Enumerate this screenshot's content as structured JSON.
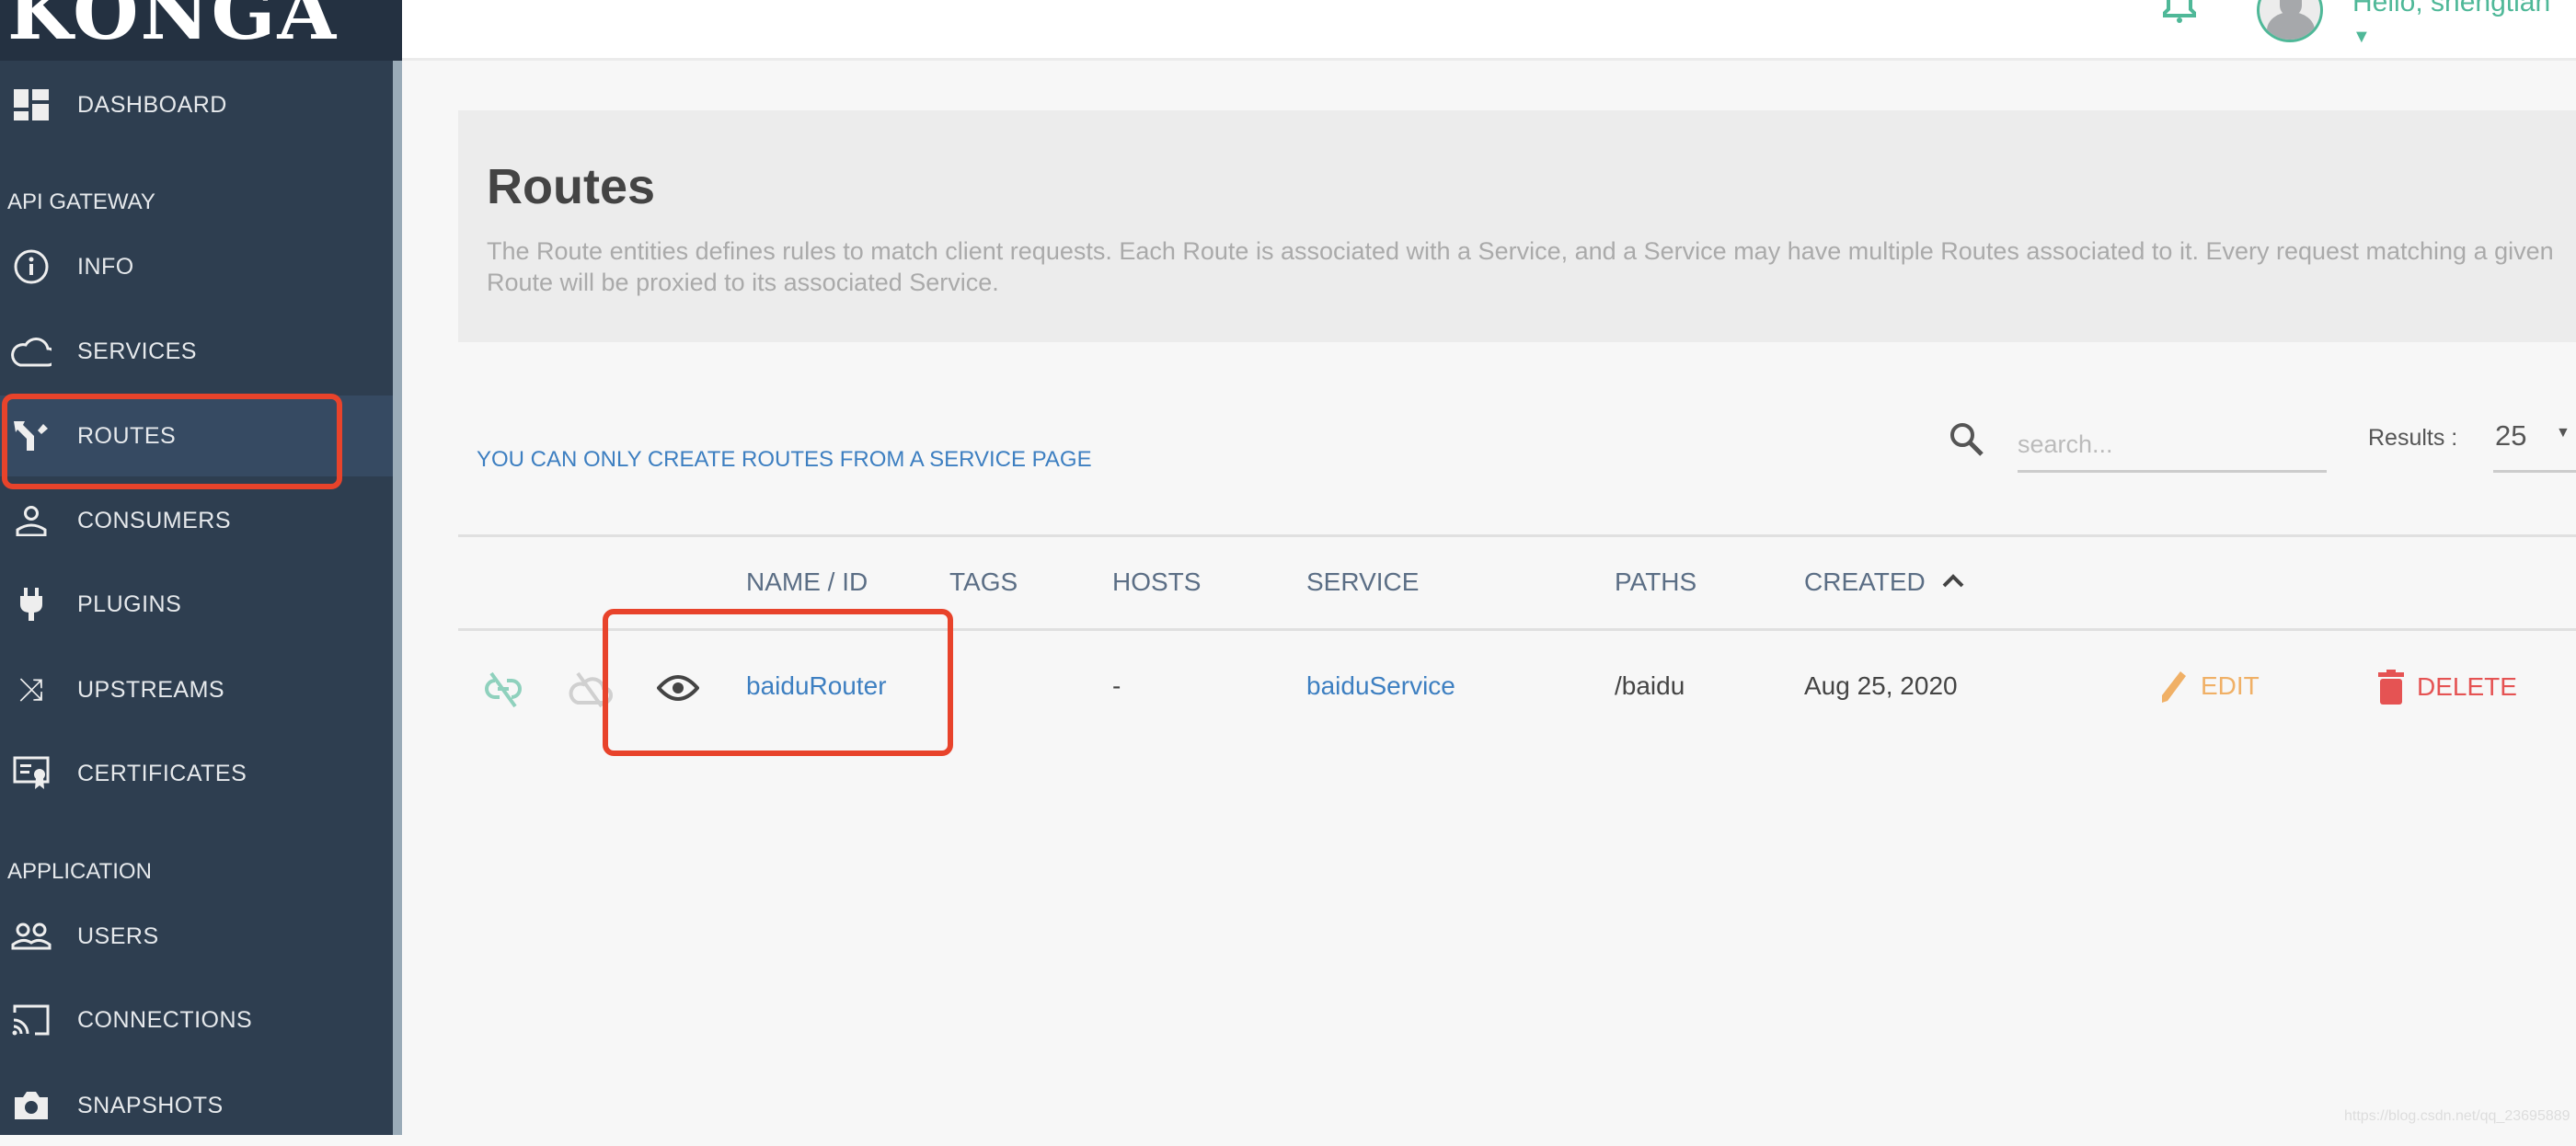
{
  "app": {
    "logo": "KONGA"
  },
  "topbar": {
    "greeting": "Hello, shengtian"
  },
  "sidebar": {
    "dashboard": "DASHBOARD",
    "sections": [
      "API GATEWAY",
      "APPLICATION"
    ],
    "api_items": [
      "INFO",
      "SERVICES",
      "ROUTES",
      "CONSUMERS",
      "PLUGINS",
      "UPSTREAMS",
      "CERTIFICATES"
    ],
    "app_items": [
      "USERS",
      "CONNECTIONS",
      "SNAPSHOTS"
    ],
    "active": "ROUTES"
  },
  "page": {
    "title": "Routes",
    "description": "The Route entities defines rules to match client requests. Each Route is associated with a Service, and a Service may have multiple Routes associated to it. Every request matching a given Route will be proxied to its associated Service.",
    "notice": "YOU CAN ONLY CREATE ROUTES FROM A SERVICE PAGE",
    "search_placeholder": "search...",
    "results_label": "Results :",
    "results_value": "25"
  },
  "table": {
    "headers": [
      "NAME / ID",
      "TAGS",
      "HOSTS",
      "SERVICE",
      "PATHS",
      "CREATED"
    ],
    "rows": [
      {
        "name": "baiduRouter",
        "tags": "",
        "hosts": "-",
        "service": "baiduService",
        "paths": "/baidu",
        "created": "Aug 25, 2020",
        "edit": "EDIT",
        "delete": "DELETE"
      }
    ]
  },
  "colors": {
    "sidebar": "#2e3e50",
    "accent": "#4fb898",
    "link": "#3d7fc1",
    "edit": "#f0b066",
    "delete": "#e55353",
    "highlight": "#e8432b"
  },
  "watermark": "https://blog.csdn.net/qq_23695889"
}
